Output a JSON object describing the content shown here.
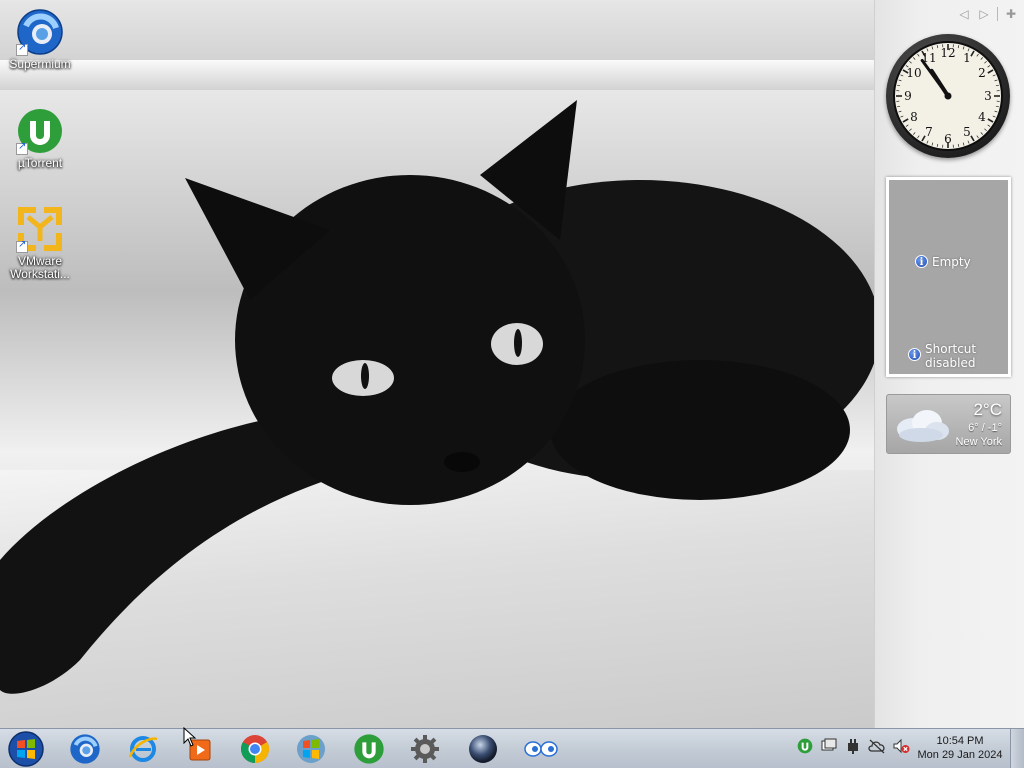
{
  "desktop": {
    "icons": [
      {
        "label": "Supermium",
        "icon": "supermium-icon"
      },
      {
        "label": "µTorrent",
        "icon": "utorrent-icon"
      },
      {
        "label": "VMware Workstati...",
        "icon": "vmware-icon"
      }
    ]
  },
  "gadgets": {
    "clock": {
      "time": "10:54"
    },
    "slideshow": {
      "empty_label": "Empty",
      "shortcut_label": "Shortcut disabled"
    },
    "weather": {
      "temperature": "2°C",
      "range": "6° / -1°",
      "city": "New York"
    }
  },
  "taskbar": {
    "items": [
      {
        "name": "supermium",
        "icon": "supermium-icon"
      },
      {
        "name": "internet-explorer",
        "icon": "ie-icon"
      },
      {
        "name": "media-player",
        "icon": "media-player-icon"
      },
      {
        "name": "chrome",
        "icon": "chrome-icon"
      },
      {
        "name": "windows",
        "icon": "windows-icon"
      },
      {
        "name": "utorrent",
        "icon": "utorrent-icon"
      },
      {
        "name": "settings",
        "icon": "gear-icon"
      },
      {
        "name": "orb",
        "icon": "orb-icon"
      },
      {
        "name": "eyes",
        "icon": "eyes-icon"
      }
    ],
    "tray": {
      "time": "10:54 PM",
      "date": "Mon 29 Jan 2024"
    }
  },
  "colors": {
    "accent": "#1a5fd0",
    "utorrent_green": "#2e9e3a",
    "vmware_yellow": "#f2b61c"
  }
}
